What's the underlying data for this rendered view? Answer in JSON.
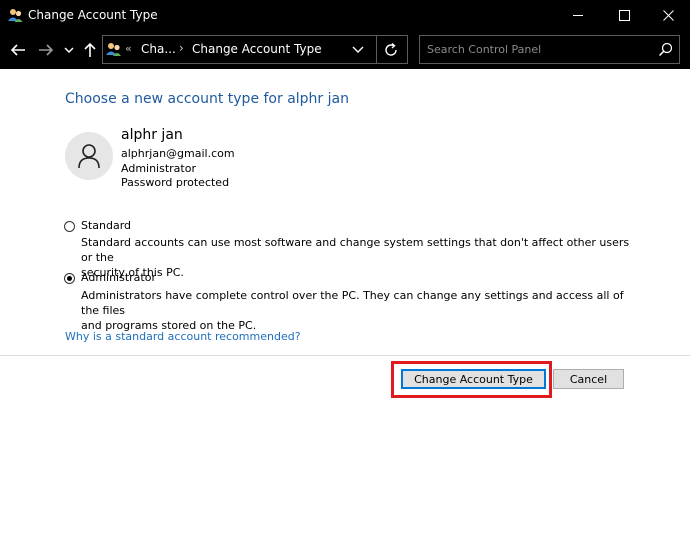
{
  "window": {
    "title": "Change Account Type",
    "title_icon": "user-accounts-icon",
    "controls": [
      "minimize-icon",
      "maximize-icon",
      "close-icon"
    ]
  },
  "navigation": {
    "back_icon": "arrow-left-icon",
    "forward_icon": "arrow-right-icon",
    "recent_icon": "chevron-down-icon",
    "up_icon": "arrow-up-icon",
    "address": {
      "overflow": "«",
      "crumb_1": "Cha...",
      "separator": "›",
      "crumb_2": "Change Account Type"
    },
    "refresh_icon": "refresh-icon",
    "search_placeholder": "Search Control Panel"
  },
  "content": {
    "heading": "Choose a new account type for alphr jan",
    "user": {
      "name": "alphr jan",
      "email": "alphrjan@gmail.com",
      "role": "Administrator",
      "password_status": "Password protected"
    },
    "options": [
      {
        "label": "Standard",
        "selected": false,
        "description": "Standard accounts can use most software and change system settings that don't affect other users or the\nsecurity of this PC."
      },
      {
        "label": "Administrator",
        "selected": true,
        "description": "Administrators have complete control over the PC. They can change any settings and access all of the files\nand programs stored on the PC."
      }
    ],
    "help_link": "Why is a standard account recommended?"
  },
  "buttons": {
    "change": "Change Account Type",
    "cancel": "Cancel"
  },
  "colors": {
    "heading": "#1e5a9e",
    "link": "#1e6fbf",
    "highlight": "#e0191f",
    "focus_border": "#0078d7"
  }
}
